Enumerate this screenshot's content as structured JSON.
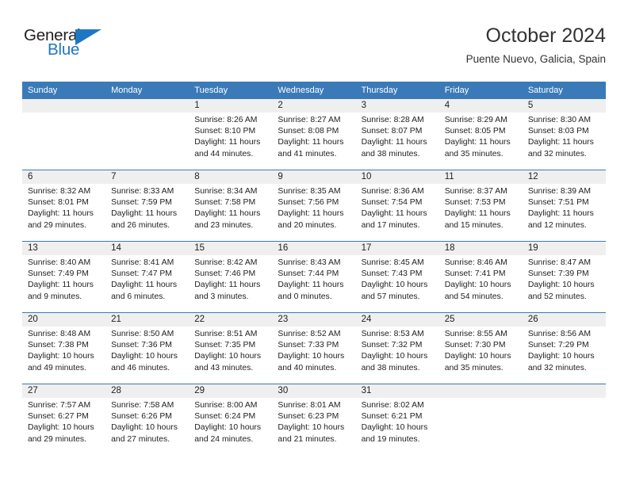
{
  "brand": {
    "name_part1": "General",
    "name_part2": "Blue",
    "logo_icon": "triangle-icon",
    "color_dark": "#231f20",
    "color_blue": "#1f77c4"
  },
  "header": {
    "month_title": "October 2024",
    "location": "Puente Nuevo, Galicia, Spain"
  },
  "theme": {
    "header_blue": "#3b7ab8",
    "daynum_band": "#efefef",
    "text": "#222222",
    "page_background": "#ffffff"
  },
  "calendar": {
    "weekdays": [
      "Sunday",
      "Monday",
      "Tuesday",
      "Wednesday",
      "Thursday",
      "Friday",
      "Saturday"
    ],
    "weeks": [
      [
        {
          "day": "",
          "lines": []
        },
        {
          "day": "",
          "lines": []
        },
        {
          "day": "1",
          "lines": [
            "Sunrise: 8:26 AM",
            "Sunset: 8:10 PM",
            "Daylight: 11 hours",
            "and 44 minutes."
          ]
        },
        {
          "day": "2",
          "lines": [
            "Sunrise: 8:27 AM",
            "Sunset: 8:08 PM",
            "Daylight: 11 hours",
            "and 41 minutes."
          ]
        },
        {
          "day": "3",
          "lines": [
            "Sunrise: 8:28 AM",
            "Sunset: 8:07 PM",
            "Daylight: 11 hours",
            "and 38 minutes."
          ]
        },
        {
          "day": "4",
          "lines": [
            "Sunrise: 8:29 AM",
            "Sunset: 8:05 PM",
            "Daylight: 11 hours",
            "and 35 minutes."
          ]
        },
        {
          "day": "5",
          "lines": [
            "Sunrise: 8:30 AM",
            "Sunset: 8:03 PM",
            "Daylight: 11 hours",
            "and 32 minutes."
          ]
        }
      ],
      [
        {
          "day": "6",
          "lines": [
            "Sunrise: 8:32 AM",
            "Sunset: 8:01 PM",
            "Daylight: 11 hours",
            "and 29 minutes."
          ]
        },
        {
          "day": "7",
          "lines": [
            "Sunrise: 8:33 AM",
            "Sunset: 7:59 PM",
            "Daylight: 11 hours",
            "and 26 minutes."
          ]
        },
        {
          "day": "8",
          "lines": [
            "Sunrise: 8:34 AM",
            "Sunset: 7:58 PM",
            "Daylight: 11 hours",
            "and 23 minutes."
          ]
        },
        {
          "day": "9",
          "lines": [
            "Sunrise: 8:35 AM",
            "Sunset: 7:56 PM",
            "Daylight: 11 hours",
            "and 20 minutes."
          ]
        },
        {
          "day": "10",
          "lines": [
            "Sunrise: 8:36 AM",
            "Sunset: 7:54 PM",
            "Daylight: 11 hours",
            "and 17 minutes."
          ]
        },
        {
          "day": "11",
          "lines": [
            "Sunrise: 8:37 AM",
            "Sunset: 7:53 PM",
            "Daylight: 11 hours",
            "and 15 minutes."
          ]
        },
        {
          "day": "12",
          "lines": [
            "Sunrise: 8:39 AM",
            "Sunset: 7:51 PM",
            "Daylight: 11 hours",
            "and 12 minutes."
          ]
        }
      ],
      [
        {
          "day": "13",
          "lines": [
            "Sunrise: 8:40 AM",
            "Sunset: 7:49 PM",
            "Daylight: 11 hours",
            "and 9 minutes."
          ]
        },
        {
          "day": "14",
          "lines": [
            "Sunrise: 8:41 AM",
            "Sunset: 7:47 PM",
            "Daylight: 11 hours",
            "and 6 minutes."
          ]
        },
        {
          "day": "15",
          "lines": [
            "Sunrise: 8:42 AM",
            "Sunset: 7:46 PM",
            "Daylight: 11 hours",
            "and 3 minutes."
          ]
        },
        {
          "day": "16",
          "lines": [
            "Sunrise: 8:43 AM",
            "Sunset: 7:44 PM",
            "Daylight: 11 hours",
            "and 0 minutes."
          ]
        },
        {
          "day": "17",
          "lines": [
            "Sunrise: 8:45 AM",
            "Sunset: 7:43 PM",
            "Daylight: 10 hours",
            "and 57 minutes."
          ]
        },
        {
          "day": "18",
          "lines": [
            "Sunrise: 8:46 AM",
            "Sunset: 7:41 PM",
            "Daylight: 10 hours",
            "and 54 minutes."
          ]
        },
        {
          "day": "19",
          "lines": [
            "Sunrise: 8:47 AM",
            "Sunset: 7:39 PM",
            "Daylight: 10 hours",
            "and 52 minutes."
          ]
        }
      ],
      [
        {
          "day": "20",
          "lines": [
            "Sunrise: 8:48 AM",
            "Sunset: 7:38 PM",
            "Daylight: 10 hours",
            "and 49 minutes."
          ]
        },
        {
          "day": "21",
          "lines": [
            "Sunrise: 8:50 AM",
            "Sunset: 7:36 PM",
            "Daylight: 10 hours",
            "and 46 minutes."
          ]
        },
        {
          "day": "22",
          "lines": [
            "Sunrise: 8:51 AM",
            "Sunset: 7:35 PM",
            "Daylight: 10 hours",
            "and 43 minutes."
          ]
        },
        {
          "day": "23",
          "lines": [
            "Sunrise: 8:52 AM",
            "Sunset: 7:33 PM",
            "Daylight: 10 hours",
            "and 40 minutes."
          ]
        },
        {
          "day": "24",
          "lines": [
            "Sunrise: 8:53 AM",
            "Sunset: 7:32 PM",
            "Daylight: 10 hours",
            "and 38 minutes."
          ]
        },
        {
          "day": "25",
          "lines": [
            "Sunrise: 8:55 AM",
            "Sunset: 7:30 PM",
            "Daylight: 10 hours",
            "and 35 minutes."
          ]
        },
        {
          "day": "26",
          "lines": [
            "Sunrise: 8:56 AM",
            "Sunset: 7:29 PM",
            "Daylight: 10 hours",
            "and 32 minutes."
          ]
        }
      ],
      [
        {
          "day": "27",
          "lines": [
            "Sunrise: 7:57 AM",
            "Sunset: 6:27 PM",
            "Daylight: 10 hours",
            "and 29 minutes."
          ]
        },
        {
          "day": "28",
          "lines": [
            "Sunrise: 7:58 AM",
            "Sunset: 6:26 PM",
            "Daylight: 10 hours",
            "and 27 minutes."
          ]
        },
        {
          "day": "29",
          "lines": [
            "Sunrise: 8:00 AM",
            "Sunset: 6:24 PM",
            "Daylight: 10 hours",
            "and 24 minutes."
          ]
        },
        {
          "day": "30",
          "lines": [
            "Sunrise: 8:01 AM",
            "Sunset: 6:23 PM",
            "Daylight: 10 hours",
            "and 21 minutes."
          ]
        },
        {
          "day": "31",
          "lines": [
            "Sunrise: 8:02 AM",
            "Sunset: 6:21 PM",
            "Daylight: 10 hours",
            "and 19 minutes."
          ]
        },
        {
          "day": "",
          "lines": []
        },
        {
          "day": "",
          "lines": []
        }
      ]
    ]
  }
}
